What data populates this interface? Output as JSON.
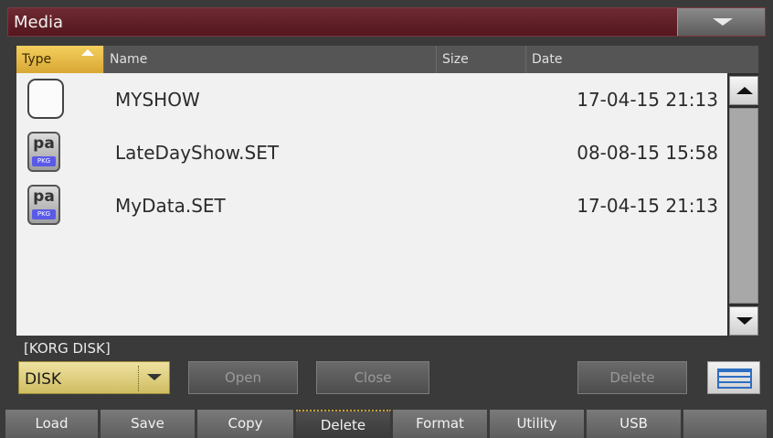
{
  "window": {
    "title": "Media"
  },
  "columns": {
    "type": "Type",
    "name": "Name",
    "size": "Size",
    "date": "Date"
  },
  "files": [
    {
      "icon": "folder-icon",
      "name": "MYSHOW",
      "size": "",
      "date": "17-04-15 21:13"
    },
    {
      "icon": "pa-file-icon",
      "icon_label": "pa",
      "icon_badge": "PKG",
      "name": "LateDayShow.SET",
      "size": "",
      "date": "08-08-15 15:58"
    },
    {
      "icon": "pa-file-icon",
      "icon_label": "pa",
      "icon_badge": "PKG",
      "name": "MyData.SET",
      "size": "",
      "date": "17-04-15 21:13"
    }
  ],
  "path": "[KORG DISK]",
  "device": {
    "selected": "DISK"
  },
  "buttons": {
    "open": "Open",
    "close": "Close",
    "delete": "Delete"
  },
  "tabs": [
    {
      "label": "Load"
    },
    {
      "label": "Save"
    },
    {
      "label": "Copy"
    },
    {
      "label": "Delete",
      "active": true
    },
    {
      "label": "Format"
    },
    {
      "label": "Utility"
    },
    {
      "label": "USB"
    },
    {
      "label": ""
    }
  ],
  "colors": {
    "title_bar": "#5f1f27",
    "sort_column": "#e8bb44",
    "device_select": "#e2d38a",
    "view_icon": "#2d6ec2"
  }
}
